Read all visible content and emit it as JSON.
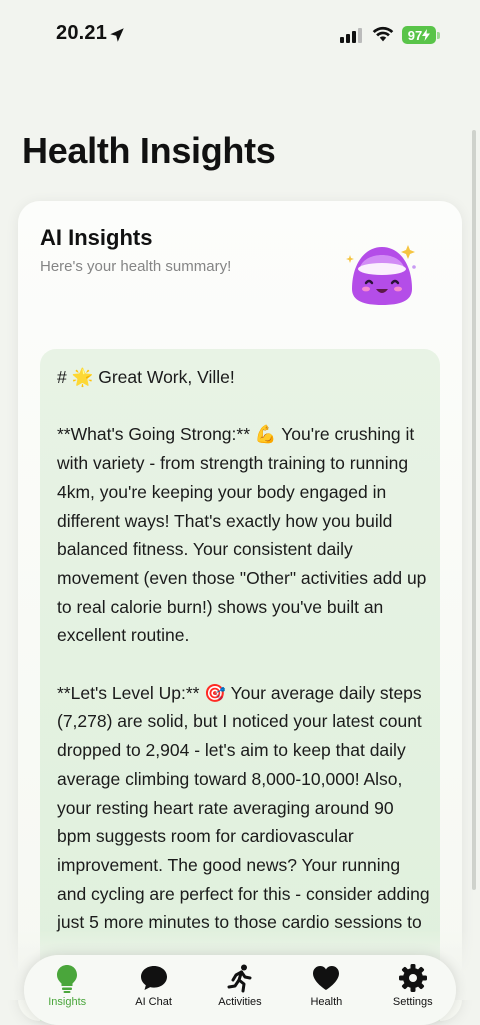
{
  "status_bar": {
    "time": "20.21",
    "battery": "97"
  },
  "page": {
    "title": "Health Insights"
  },
  "card": {
    "title": "AI Insights",
    "subtitle": "Here's your health summary!",
    "mascot_icon": "smiling-purple-blob-mascot",
    "insight_text": "# 🌟 Great Work, Ville!\n\n**What's Going Strong:** 💪 You're crushing it with variety - from strength training to running 4km, you're keeping your body engaged in different ways! That's exactly how you build balanced fitness. Your consistent daily movement (even those \"Other\" activities add up to real calorie burn!) shows you've built an excellent routine.\n\n**Let's Level Up:** 🎯 Your average daily steps (7,278) are solid, but I noticed your latest count dropped to 2,904 - let's aim to keep that daily average climbing toward 8,000-10,000! Also, your resting heart rate averaging around 90 bpm suggests room for cardiovascular improvement. The good news? Your running and cycling are perfect for this - consider adding just 5 more minutes to those cardio sessions to"
  },
  "tabs": [
    {
      "label": "Insights",
      "icon": "lightbulb-icon",
      "active": true
    },
    {
      "label": "AI Chat",
      "icon": "chat-bubble-icon",
      "active": false
    },
    {
      "label": "Activities",
      "icon": "running-figure-icon",
      "active": false
    },
    {
      "label": "Health",
      "icon": "heart-icon",
      "active": false
    },
    {
      "label": "Settings",
      "icon": "gear-icon",
      "active": false
    }
  ],
  "colors": {
    "accent": "#4aa63b",
    "battery": "#59c449",
    "insight_bg": "#e3f1e0"
  }
}
